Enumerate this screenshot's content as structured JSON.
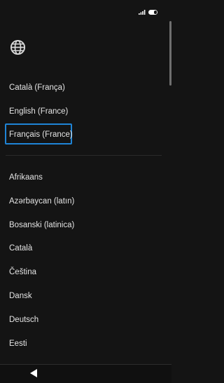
{
  "status": {
    "signal_icon": "signal-icon",
    "battery_icon": "battery-icon"
  },
  "header": {
    "icon": "globe-icon"
  },
  "suggested": [
    {
      "label": "Català (França)"
    },
    {
      "label": "English (France)"
    },
    {
      "label": "Français (France)",
      "focused": true
    }
  ],
  "all_languages": [
    {
      "label": "Afrikaans"
    },
    {
      "label": "Azərbaycan (latın)"
    },
    {
      "label": "Bosanski (latinica)"
    },
    {
      "label": "Català"
    },
    {
      "label": "Čeština"
    },
    {
      "label": "Dansk"
    },
    {
      "label": "Deutsch"
    },
    {
      "label": "Eesti"
    }
  ],
  "nav": {
    "back_icon": "back-triangle-icon"
  },
  "colors": {
    "background": "#141414",
    "focus_ring": "#1f84d6",
    "text": "#e4e4e4"
  }
}
